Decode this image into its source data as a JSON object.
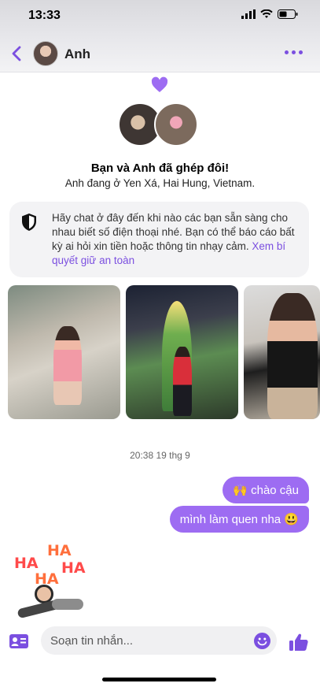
{
  "status_bar": {
    "time": "13:33"
  },
  "header": {
    "contact_name": "Anh"
  },
  "match": {
    "title": "Bạn và Anh đã ghép đôi!",
    "location": "Anh đang ở Yen Xá, Hai Hung, Vietnam."
  },
  "safety": {
    "text": "Hãy chat ở đây đến khi nào các bạn sẵn sàng cho nhau biết số điện thoại nhé. Bạn có thể báo cáo bất kỳ ai hỏi xin tiền hoặc thông tin nhạy cảm. ",
    "link": "Xem bí quyết giữ an toàn"
  },
  "conversation": {
    "timestamp": "20:38 19 thg 9",
    "messages": [
      {
        "text": "🙌 chào cậu",
        "from": "me"
      },
      {
        "text": "mình làm quen nha 😃",
        "from": "me"
      }
    ],
    "sticker": {
      "words": [
        "HA",
        "HA",
        "HA",
        "HA"
      ]
    }
  },
  "composer": {
    "placeholder": "Soạn tin nhắn..."
  },
  "colors": {
    "accent": "#7b4fe0",
    "bubble": "#9d6cf2"
  }
}
